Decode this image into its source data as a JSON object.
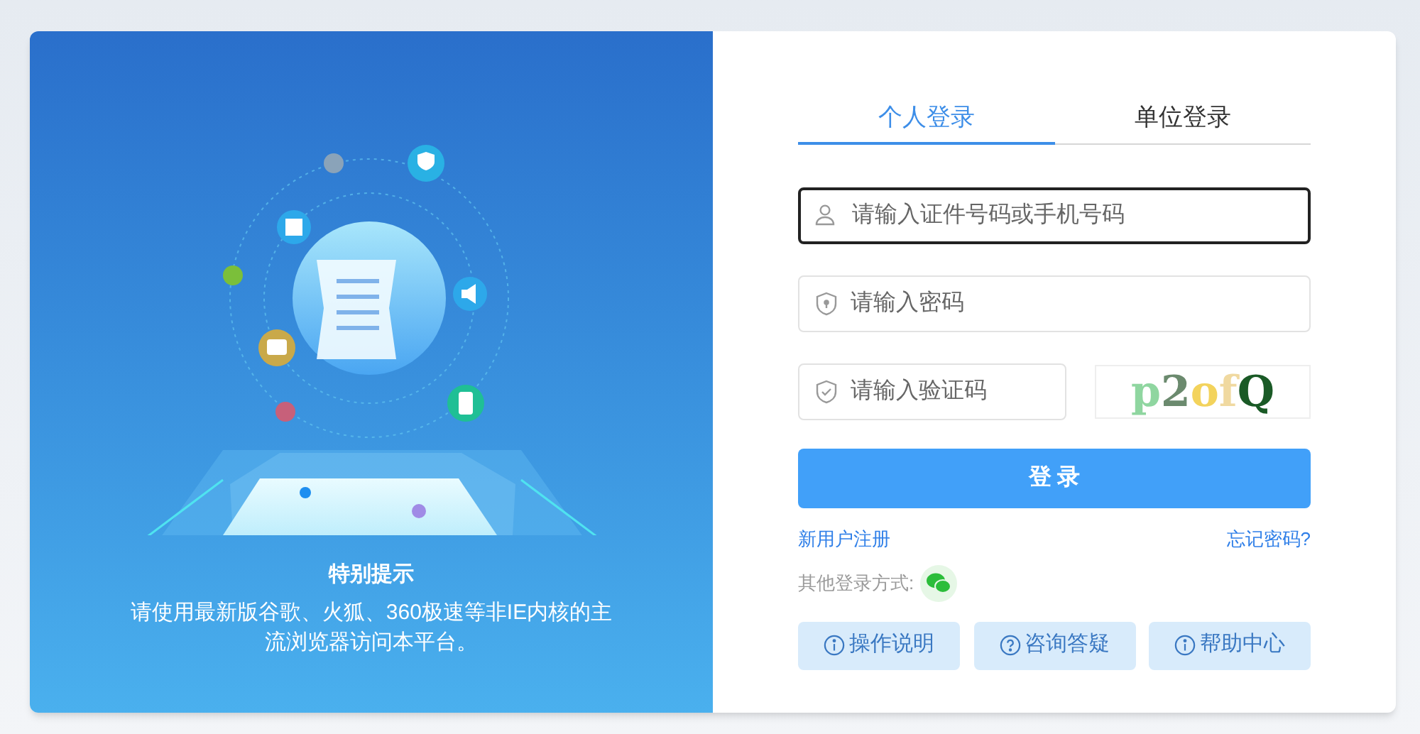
{
  "notice": {
    "title": "特别提示",
    "text": "请使用最新版谷歌、火狐、360极速等非IE内核的主流浏览器访问本平台。"
  },
  "tabs": [
    {
      "label": "个人登录",
      "selected": true
    },
    {
      "label": "单位登录",
      "selected": false
    }
  ],
  "fields": [
    {
      "kind": "user",
      "placeholder": "请输入证件号码或手机号码",
      "focused": true
    },
    {
      "kind": "password",
      "placeholder": "请输入密码",
      "focused": false
    },
    {
      "kind": "captcha",
      "placeholder": "请输入验证码",
      "focused": false
    }
  ],
  "captcha": "p2ofQ",
  "login_button": "登 录",
  "register_link": "新用户注册",
  "forgot_link": "忘记密码?",
  "other_login": "其他登录方式:",
  "help_buttons": [
    {
      "kind": "info",
      "label": "操作说明"
    },
    {
      "kind": "question",
      "label": "咨询答疑"
    },
    {
      "kind": "info",
      "label": "帮助中心"
    }
  ]
}
